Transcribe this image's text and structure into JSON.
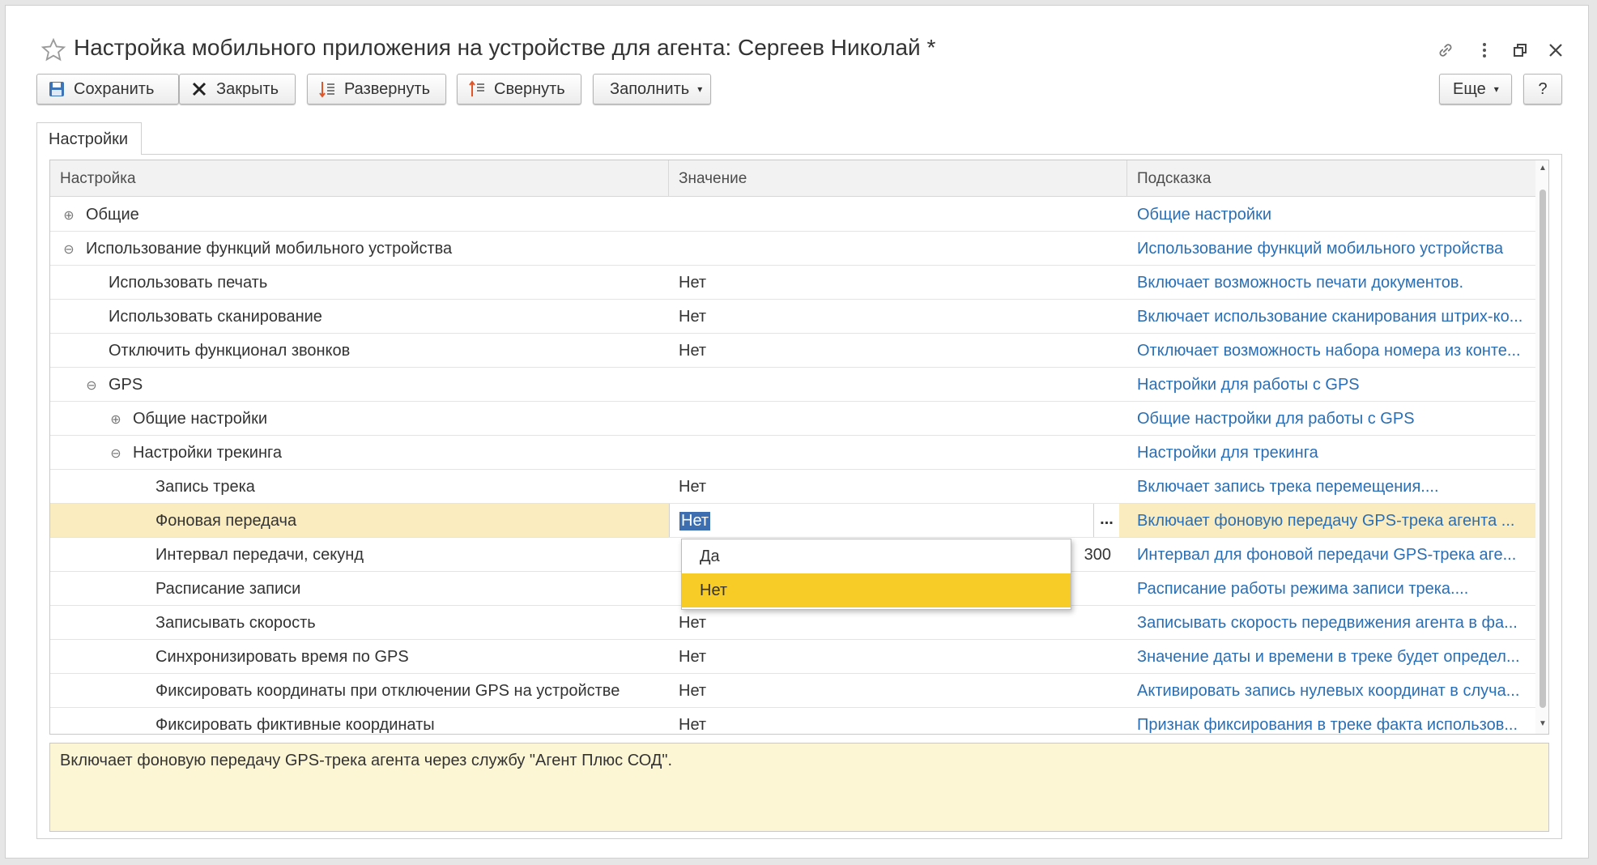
{
  "header": {
    "title": "Настройка мобильного приложения на устройстве для агента: Сергеев Николай *"
  },
  "toolbar": {
    "save": "Сохранить",
    "close": "Закрыть",
    "expand": "Развернуть",
    "collapse": "Свернуть",
    "fill": "Заполнить",
    "more": "Еще",
    "help": "?"
  },
  "tabs": [
    "Настройки"
  ],
  "grid": {
    "columns": [
      "Настройка",
      "Значение",
      "Подсказка"
    ],
    "rows": [
      {
        "name": "Общие",
        "value": "",
        "hint": "Общие настройки"
      },
      {
        "name": "Использование функций мобильного устройства",
        "value": "",
        "hint": "Использование функций мобильного устройства"
      },
      {
        "name": "Использовать печать",
        "value": "Нет",
        "hint": "Включает возможность печати документов."
      },
      {
        "name": "Использовать сканирование",
        "value": "Нет",
        "hint": "Включает использование сканирования штрих-ко..."
      },
      {
        "name": "Отключить функционал звонков",
        "value": "Нет",
        "hint": "Отключает возможность набора номера из конте..."
      },
      {
        "name": "GPS",
        "value": "",
        "hint": "Настройки для работы с GPS"
      },
      {
        "name": "Общие настройки",
        "value": "",
        "hint": "Общие настройки для работы с GPS"
      },
      {
        "name": "Настройки трекинга",
        "value": "",
        "hint": "Настройки для трекинга"
      },
      {
        "name": "Запись трека",
        "value": "Нет",
        "hint": "Включает запись трека перемещения...."
      },
      {
        "name": "Фоновая передача",
        "value": "Нет",
        "hint": "Включает фоновую передачу GPS-трека агента ..."
      },
      {
        "name": "Интервал передачи, секунд",
        "value": "300",
        "hint": "Интервал для фоновой передачи GPS-трека аге..."
      },
      {
        "name": "Расписание записи",
        "value": "",
        "hint": "Расписание работы режима записи трека...."
      },
      {
        "name": "Записывать скорость",
        "value": "Нет",
        "hint": "Записывать скорость передвижения агента в фа..."
      },
      {
        "name": "Синхронизировать время по GPS",
        "value": "Нет",
        "hint": "Значение даты и времени в треке будет определ..."
      },
      {
        "name": "Фиксировать координаты при отключении GPS на устройстве",
        "value": "Нет",
        "hint": "Активировать запись нулевых координат в случа..."
      },
      {
        "name": "Фиксировать фиктивные координаты",
        "value": "Нет",
        "hint": "Признак фиксирования в треке факта использов..."
      }
    ]
  },
  "dropdown": {
    "options": [
      "Да",
      "Нет"
    ],
    "selected": "Нет"
  },
  "hint_panel": {
    "text": "Включает фоновую передачу GPS-трека агента через службу \"Агент Плюс СОД\"."
  },
  "colors": {
    "link": "#2a6fb5",
    "selected_row": "#fbecc0",
    "dropdown_active": "#f8cc27",
    "hint_bg": "#fdf6d5"
  },
  "icons": {
    "favorite": "star-icon",
    "link": "link-icon",
    "menu": "more-vertical-icon",
    "restore": "restore-window-icon",
    "close": "close-icon"
  }
}
